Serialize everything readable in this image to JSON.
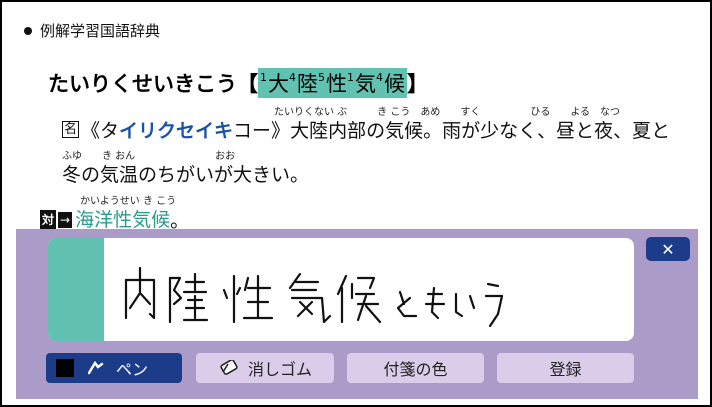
{
  "header": {
    "title": "例解学習国語辞典"
  },
  "entry": {
    "reading": "たいりくせいきこう",
    "open_bracket": "【",
    "close_bracket": "】",
    "kanji": [
      {
        "grade": "1",
        "char": "大"
      },
      {
        "grade": "4",
        "char": "陸"
      },
      {
        "grade": "5",
        "char": "性"
      },
      {
        "grade": "1",
        "char": "気"
      },
      {
        "grade": "4",
        "char": "候"
      }
    ]
  },
  "definition": {
    "ruby_line1": "たいりくない ぶ　　　き こう　あめ　　すく　　　　　ひる　　よる　なつ",
    "pos_label": "名",
    "kana_open": "《タ",
    "kana_bold": "イリクセイキ",
    "kana_close": "コー》",
    "line1_text": "大陸内部の気候。雨が少なく、昼と夜、夏と",
    "ruby_line2": "ふゆ　　き おん　　　　　　　　おお",
    "line2_text": "冬の気温のちがいが大きい。",
    "ruby_line3": "かいようせい き こう",
    "opposite_label": "対",
    "arrow_label": "→",
    "opposite_link": "海洋性気候",
    "opposite_end": "。"
  },
  "note": {
    "handwriting": "内陸性気候ともいう"
  },
  "toolbar": {
    "close_label": "✕",
    "pen_label": "ペン",
    "eraser_label": "消しゴム",
    "color_label": "付箋の色",
    "register_label": "登録"
  },
  "colors": {
    "teal": "#62c2b1",
    "navy": "#1c3c8a",
    "panel": "#aa9bc8",
    "button_light": "#d9cde9"
  }
}
